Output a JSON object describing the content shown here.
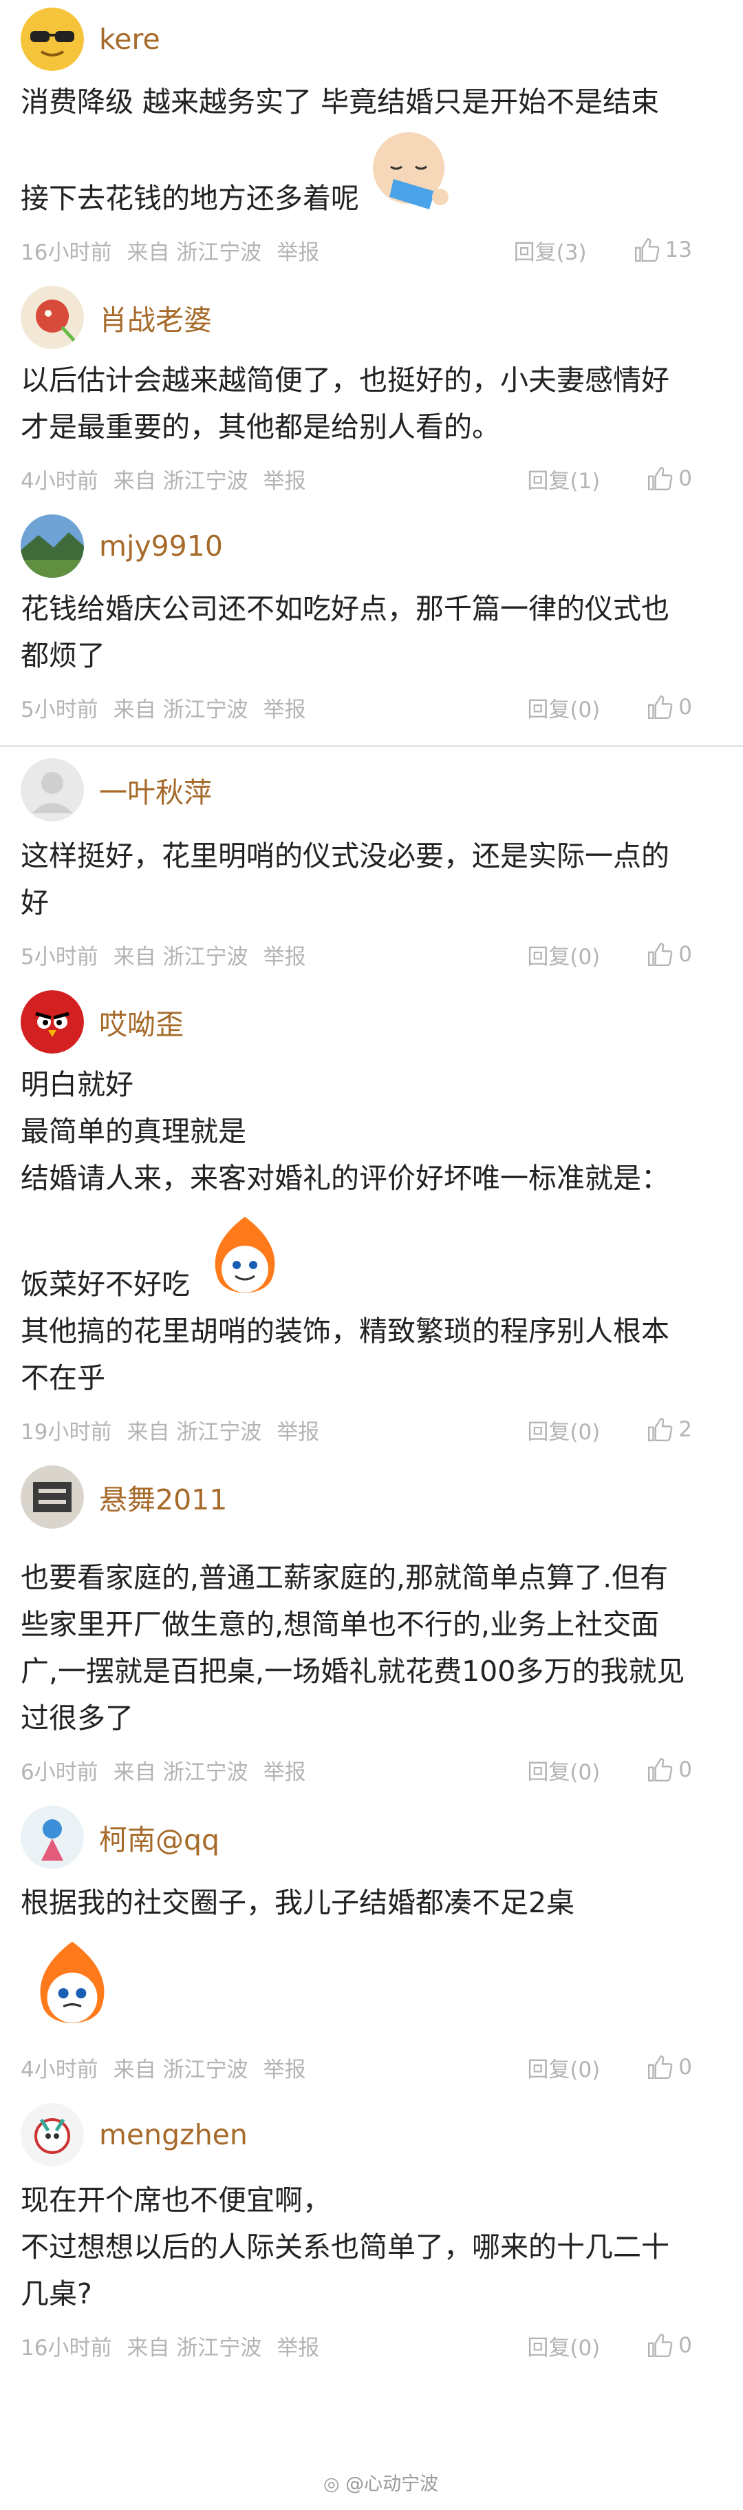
{
  "comments": [
    {
      "user": "kere",
      "lines": [
        "消费降级 越来越务实了 毕竟结婚只是开始不是结束",
        "接下去花钱的地方还多着呢"
      ],
      "time": "16小时前",
      "source": "来自 浙江宁波",
      "report": "举报",
      "reply": "回复(3)",
      "likes": "13"
    },
    {
      "user": "肖战老婆",
      "lines": [
        "以后估计会越来越简便了，也挺好的，小夫妻感情好",
        "才是最重要的，其他都是给别人看的。"
      ],
      "time": "4小时前",
      "source": "来自 浙江宁波",
      "report": "举报",
      "reply": "回复(1)",
      "likes": "0"
    },
    {
      "user": "mjy9910",
      "lines": [
        "花钱给婚庆公司还不如吃好点，那千篇一律的仪式也",
        "都烦了"
      ],
      "time": "5小时前",
      "source": "来自 浙江宁波",
      "report": "举报",
      "reply": "回复(0)",
      "likes": "0"
    },
    {
      "user": "一叶秋萍",
      "lines": [
        "这样挺好，花里明哨的仪式没必要，还是实际一点的",
        "好"
      ],
      "time": "5小时前",
      "source": "来自 浙江宁波",
      "report": "举报",
      "reply": "回复(0)",
      "likes": "0"
    },
    {
      "user": "哎呦歪",
      "lines": [
        "明白就好",
        "最简单的真理就是",
        "结婚请人来，来客对婚礼的评价好坏唯一标准就是：",
        "饭菜好不好吃",
        "其他搞的花里胡哨的装饰，精致繁琐的程序别人根本",
        "不在乎"
      ],
      "time": "19小时前",
      "source": "来自 浙江宁波",
      "report": "举报",
      "reply": "回复(0)",
      "likes": "2"
    },
    {
      "user": "悬舞2011",
      "lines": [
        "也要看家庭的,普通工薪家庭的,那就简单点算了.但有",
        "些家里开厂做生意的,想简单也不行的,业务上社交面",
        "广,一摆就是百把桌,一场婚礼就花费100多万的我就见",
        "过很多了"
      ],
      "time": "6小时前",
      "source": "来自 浙江宁波",
      "report": "举报",
      "reply": "回复(0)",
      "likes": "0"
    },
    {
      "user": "柯南@qq",
      "lines": [
        "根据我的社交圈子，我儿子结婚都凑不足2桌"
      ],
      "time": "4小时前",
      "source": "来自 浙江宁波",
      "report": "举报",
      "reply": "回复(0)",
      "likes": "0"
    },
    {
      "user": "mengzhen",
      "lines": [
        "现在开个席也不便宜啊，",
        "不过想想以后的人际关系也简单了，哪来的十几二十",
        "几桌?"
      ],
      "time": "16小时前",
      "source": "来自 浙江宁波",
      "report": "举报",
      "reply": "回复(0)",
      "likes": "0"
    }
  ],
  "watermark": "@心动宁波"
}
